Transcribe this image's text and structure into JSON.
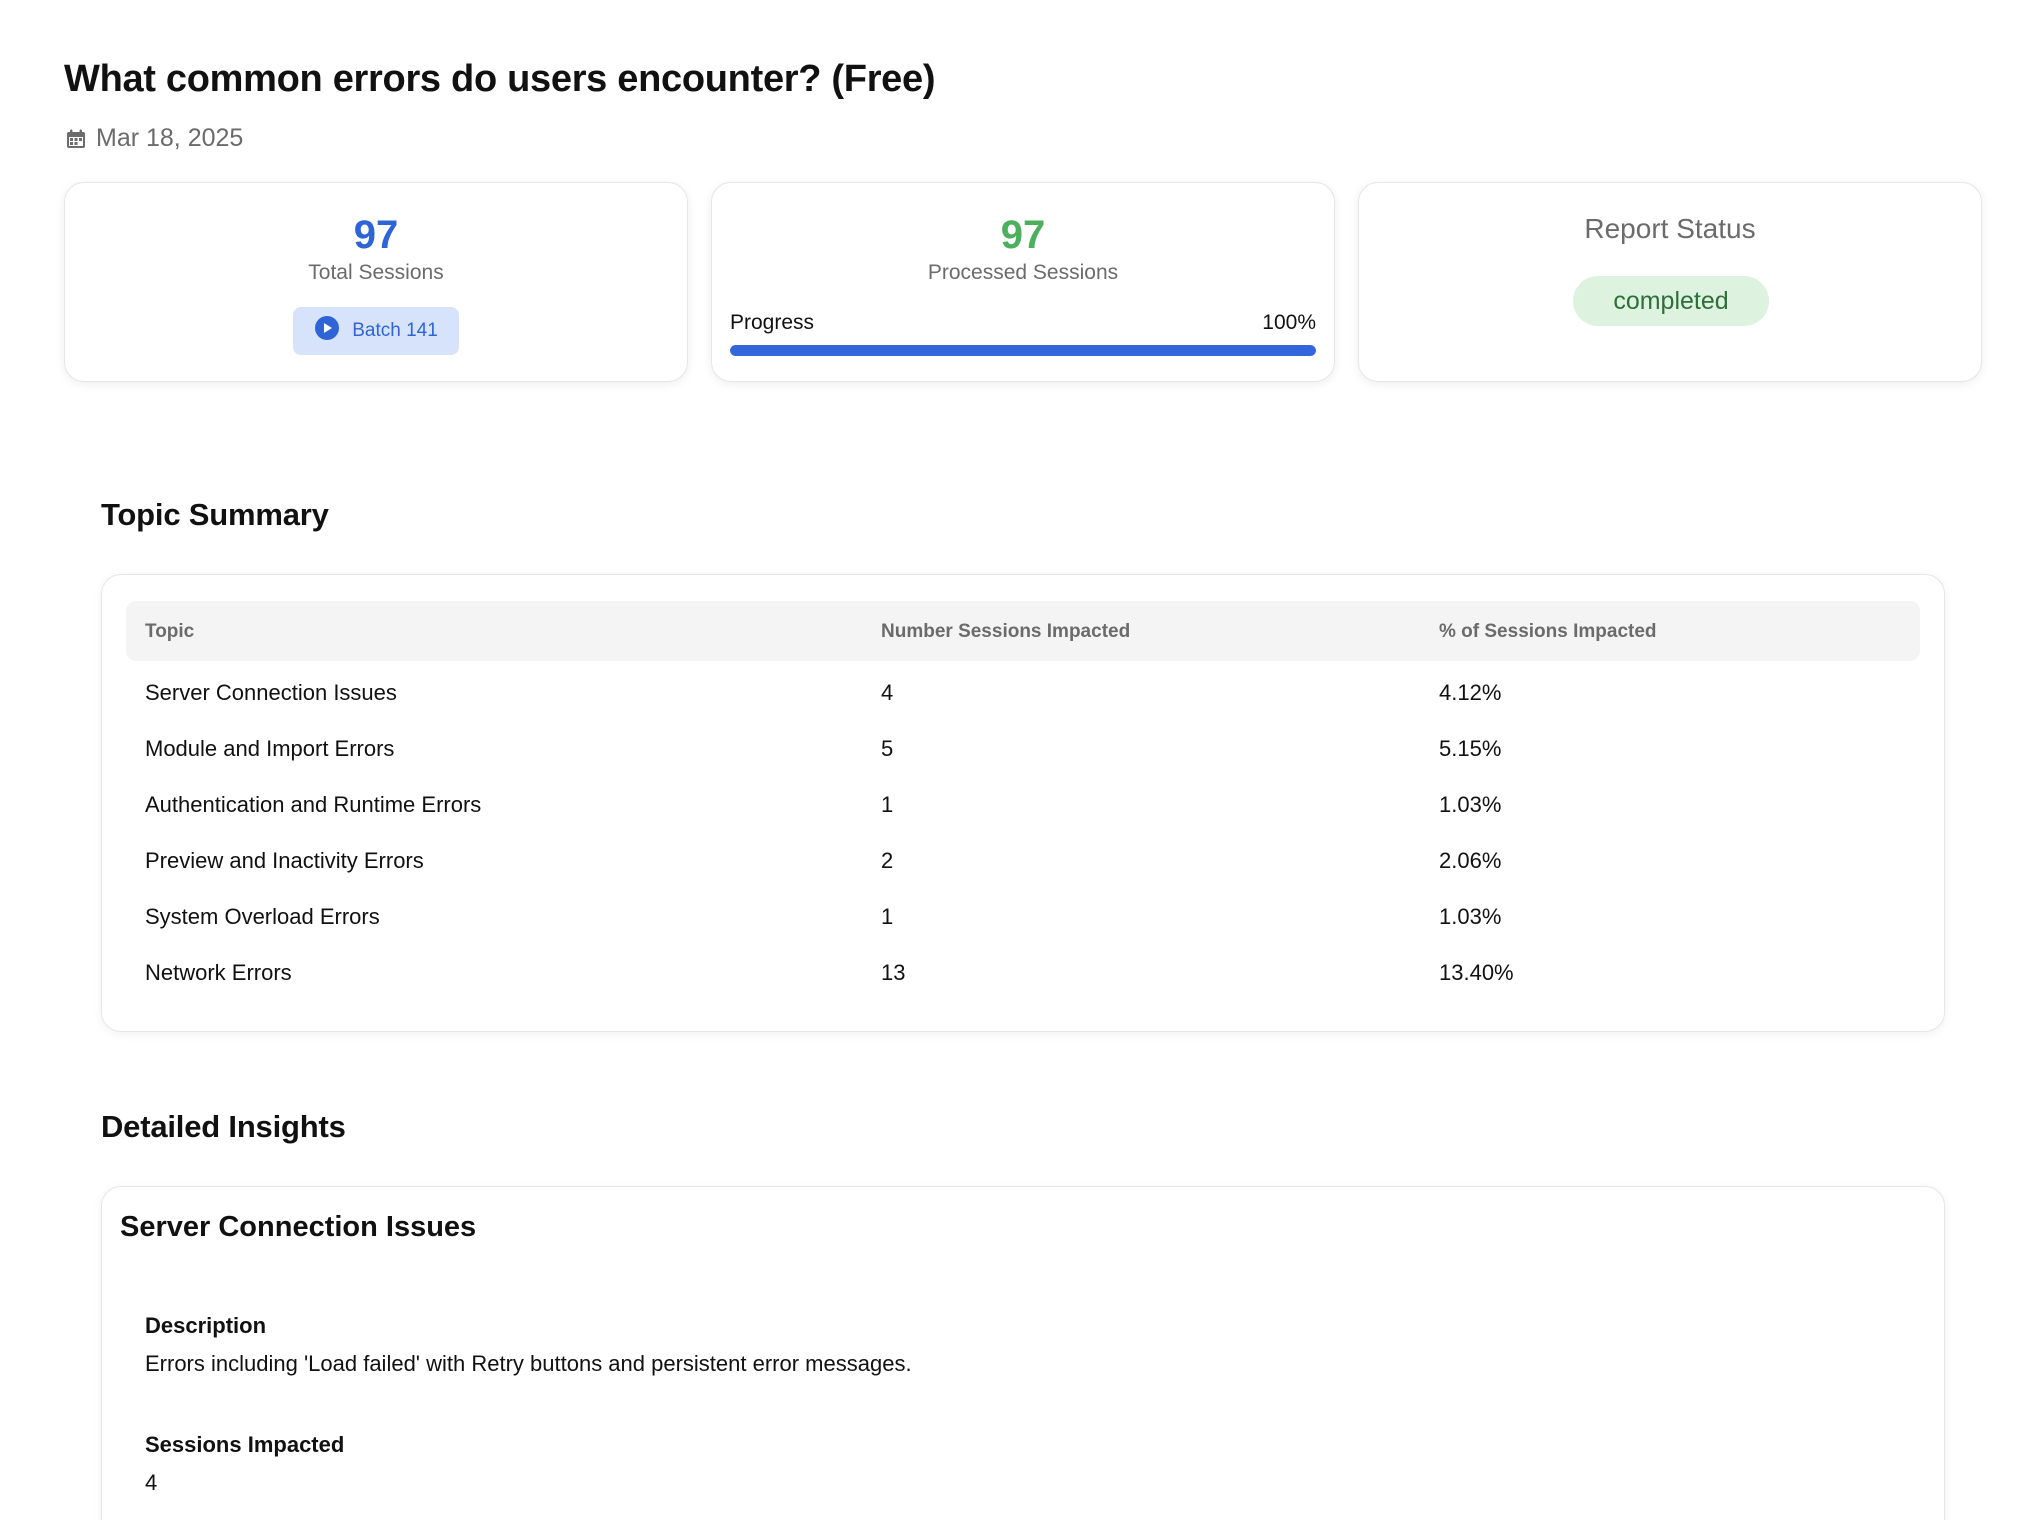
{
  "header": {
    "title": "What common errors do users encounter? (Free)",
    "date": "Mar 18, 2025",
    "date_icon": "calendar-icon"
  },
  "stats": {
    "total_sessions": {
      "value": "97",
      "label": "Total Sessions",
      "color": "#2f64d6"
    },
    "batch": {
      "label": "Batch 141",
      "icon": "play-circle-icon"
    },
    "processed_sessions": {
      "value": "97",
      "label": "Processed Sessions",
      "color": "#4caf5b"
    },
    "progress": {
      "label": "Progress",
      "value_text": "100%",
      "percent": 100
    },
    "report_status": {
      "title": "Report Status",
      "badge": "completed"
    }
  },
  "topic_summary": {
    "title": "Topic Summary",
    "columns": [
      "Topic",
      "Number Sessions Impacted",
      "% of Sessions Impacted"
    ],
    "rows": [
      {
        "topic": "Server Connection Issues",
        "count": "4",
        "percent": "4.12%"
      },
      {
        "topic": "Module and Import Errors",
        "count": "5",
        "percent": "5.15%"
      },
      {
        "topic": "Authentication and Runtime Errors",
        "count": "1",
        "percent": "1.03%"
      },
      {
        "topic": "Preview and Inactivity Errors",
        "count": "2",
        "percent": "2.06%"
      },
      {
        "topic": "System Overload Errors",
        "count": "1",
        "percent": "1.03%"
      },
      {
        "topic": "Network Errors",
        "count": "13",
        "percent": "13.40%"
      }
    ]
  },
  "detailed_insights": {
    "title": "Detailed Insights",
    "items": [
      {
        "title": "Server Connection Issues",
        "description_label": "Description",
        "description": "Errors including 'Load failed' with Retry buttons and persistent error messages.",
        "sessions_label": "Sessions Impacted",
        "sessions": "4"
      }
    ]
  }
}
